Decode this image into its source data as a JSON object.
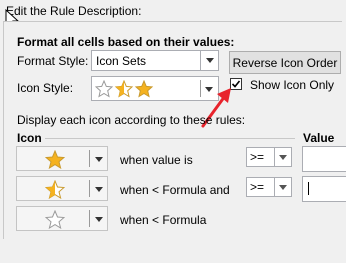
{
  "section_title": "Edit the Rule Description:",
  "format_all_heading": "Format all cells based on their values:",
  "format_style": {
    "label": "Format Style:",
    "value": "Icon Sets"
  },
  "reverse_button": "Reverse Icon Order",
  "icon_style": {
    "label": "Icon Style:"
  },
  "show_icon_only": {
    "label": "Show Icon Only",
    "checked": true
  },
  "display_rules_text": "Display each icon according to these rules:",
  "columns": {
    "icon": "Icon",
    "value": "Value"
  },
  "rules": [
    {
      "icon": "star-full-icon",
      "text": "when value is",
      "operator": ">="
    },
    {
      "icon": "star-half-icon",
      "text": "when < Formula and",
      "operator": ">="
    },
    {
      "icon": "star-empty-icon",
      "text": "when < Formula",
      "operator": ""
    }
  ],
  "colors": {
    "star_gold": "#f5b21f",
    "star_outline": "#a0a0a0",
    "arrow_red": "#e8232c"
  }
}
